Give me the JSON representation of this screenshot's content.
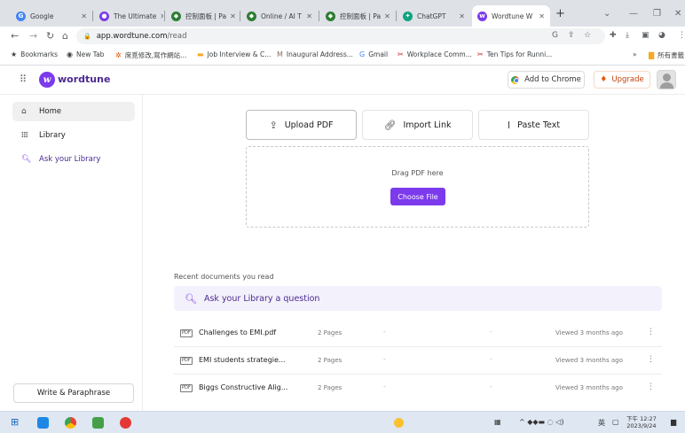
{
  "browser": {
    "tabs": [
      {
        "title": "Google",
        "favicon": "G",
        "color": "#4285f4",
        "active": false
      },
      {
        "title": "The Ultimate",
        "favicon": "●",
        "color": "#7c3aed",
        "active": false
      },
      {
        "title": "控制面板 | Pa",
        "favicon": "◆",
        "color": "#2e7d32",
        "active": false
      },
      {
        "title": "Online / AI T",
        "favicon": "◆",
        "color": "#2e7d32",
        "active": false
      },
      {
        "title": "控制面板 | Pa",
        "favicon": "◆",
        "color": "#2e7d32",
        "active": false
      },
      {
        "title": "ChatGPT",
        "favicon": "✦",
        "color": "#10a37f",
        "active": false
      },
      {
        "title": "Wordtune W",
        "favicon": "w",
        "color": "#7c3aed",
        "active": true
      }
    ],
    "url_host": "app.wordtune.com",
    "url_path": "/read",
    "bookmarks": [
      {
        "label": "Bookmarks",
        "icon": "★"
      },
      {
        "label": "New Tab",
        "icon": "◉"
      },
      {
        "label": "席覓修改,寫作網站...",
        "icon": "✲"
      },
      {
        "label": "Job Interview & C...",
        "icon": "▬"
      },
      {
        "label": "Inaugural Address...",
        "icon": "M"
      },
      {
        "label": "Gmail",
        "icon": "G"
      },
      {
        "label": "Workplace Comm...",
        "icon": "✂"
      },
      {
        "label": "Ten Tips for Runni...",
        "icon": "✂"
      }
    ],
    "bookmarks_right": "所有書籤"
  },
  "header": {
    "logo_text": "wordtune",
    "add_to_chrome": "Add to Chrome",
    "upgrade": "Upgrade"
  },
  "sidebar": {
    "items": [
      {
        "label": "Home",
        "icon": "home-icon"
      },
      {
        "label": "Library",
        "icon": "library-icon"
      },
      {
        "label": "Ask your Library",
        "icon": "sparkle-search-icon"
      }
    ],
    "write_button": "Write & Paraphrase"
  },
  "main": {
    "actions": [
      {
        "label": "Upload PDF",
        "icon": "upload-icon"
      },
      {
        "label": "Import Link",
        "icon": "link-icon"
      },
      {
        "label": "Paste Text",
        "icon": "text-cursor-icon"
      }
    ],
    "drop_text": "Drag PDF here",
    "choose_file": "Choose File",
    "recent_label": "Recent documents you read",
    "ask_placeholder": "Ask your Library a question",
    "documents": [
      {
        "name": "Challenges to EMI.pdf",
        "pages": "2 Pages",
        "col3": "-",
        "col4": "-",
        "viewed": "Viewed 3 months ago",
        "badge": "PDF"
      },
      {
        "name": "EMI students strategie...",
        "pages": "2 Pages",
        "col3": "-",
        "col4": "-",
        "viewed": "Viewed 3 months ago",
        "badge": "PDF"
      },
      {
        "name": "Biggs Constructive Alig...",
        "pages": "2 Pages",
        "col3": "-",
        "col4": "-",
        "viewed": "Viewed 3 months ago",
        "badge": "PDF"
      }
    ]
  },
  "taskbar": {
    "ime": "英",
    "time": "下午 12:27",
    "date": "2023/9/24"
  },
  "colors": {
    "accent": "#7c3aed",
    "upgrade": "#ea580c"
  }
}
